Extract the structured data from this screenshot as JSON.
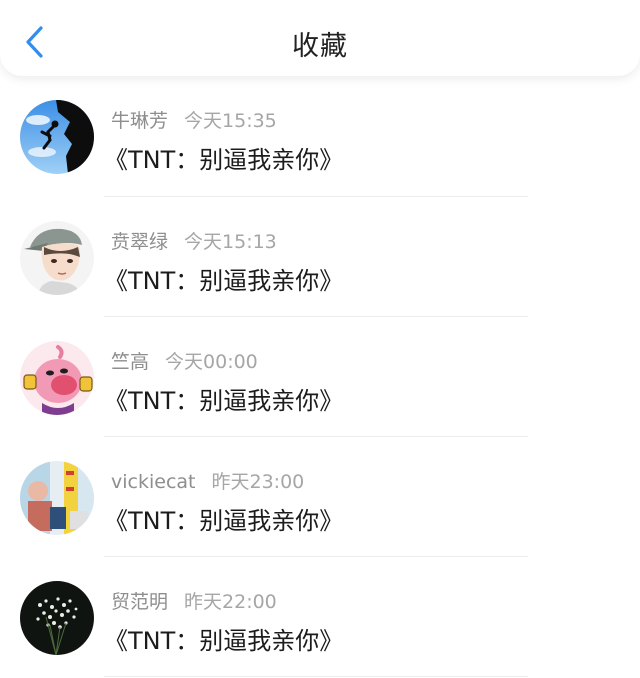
{
  "header": {
    "title": "收藏",
    "back_icon": "chevron-left-icon",
    "accent_color": "#2f8ef0"
  },
  "items": [
    {
      "user": "牛琳芳",
      "time": "今天15:35",
      "content": "《TNT：别逼我亲你》",
      "avatar": "climber-silhouette"
    },
    {
      "user": "贲翠绿",
      "time": "今天15:13",
      "content": "《TNT：别逼我亲你》",
      "avatar": "anime-boy-cap"
    },
    {
      "user": "竺高",
      "time": "今天00:00",
      "content": "《TNT：别逼我亲你》",
      "avatar": "pink-cartoon"
    },
    {
      "user": "vickiecat",
      "time": "昨天23:00",
      "content": "《TNT：别逼我亲你》",
      "avatar": "photo-collage"
    },
    {
      "user": "贸范明",
      "time": "昨天22:00",
      "content": "《TNT：别逼我亲你》",
      "avatar": "flowers-dark"
    }
  ]
}
